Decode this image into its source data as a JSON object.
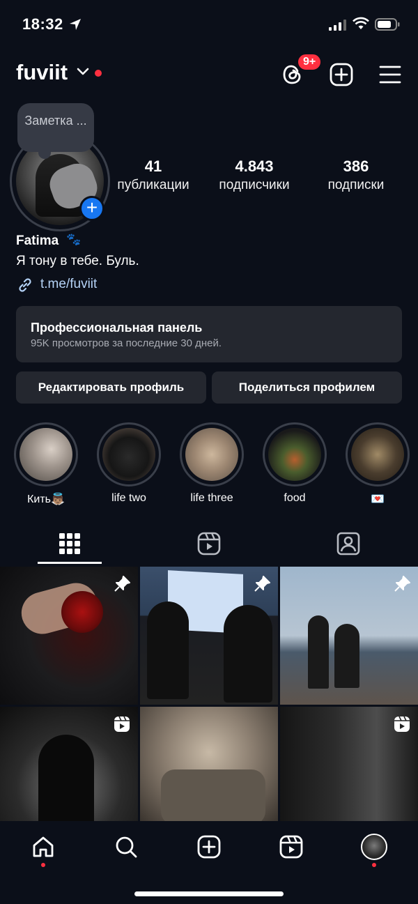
{
  "status_bar": {
    "time": "18:32"
  },
  "header": {
    "username": "fuviit",
    "notif_badge": "9+"
  },
  "note": {
    "text": "Заметка ..."
  },
  "stats": [
    {
      "value": "41",
      "label": "публикации"
    },
    {
      "value": "4.843",
      "label": "подписчики"
    },
    {
      "value": "386",
      "label": "подписки"
    }
  ],
  "profile": {
    "name": "Fatima",
    "name_emoji": "🐾",
    "bio": "Я тону в тебе. Буль.",
    "link": "t.me/fuviit"
  },
  "pro_panel": {
    "title": "Профессиональная панель",
    "subtitle": "95K просмотров за последние 30 дней."
  },
  "buttons": {
    "edit": "Редактировать профиль",
    "share": "Поделиться профилем"
  },
  "highlights": [
    {
      "label": "Кить👼🏽"
    },
    {
      "label": "life two"
    },
    {
      "label": "life three"
    },
    {
      "label": "food"
    },
    {
      "label": "💌"
    }
  ],
  "tabs": [
    "grid-icon",
    "reels-icon",
    "tagged-icon"
  ],
  "grid_posts": [
    {
      "type": "pinned"
    },
    {
      "type": "pinned"
    },
    {
      "type": "pinned"
    },
    {
      "type": "reel"
    },
    {
      "type": "none"
    },
    {
      "type": "reel"
    }
  ],
  "nav": [
    "home-icon",
    "search-icon",
    "create-icon",
    "reels-icon",
    "profile-avatar"
  ],
  "colors": {
    "background": "#0b0f19",
    "accent_blue": "#1877f2",
    "notification_red": "#ff3040",
    "link": "#b5d3f7"
  }
}
